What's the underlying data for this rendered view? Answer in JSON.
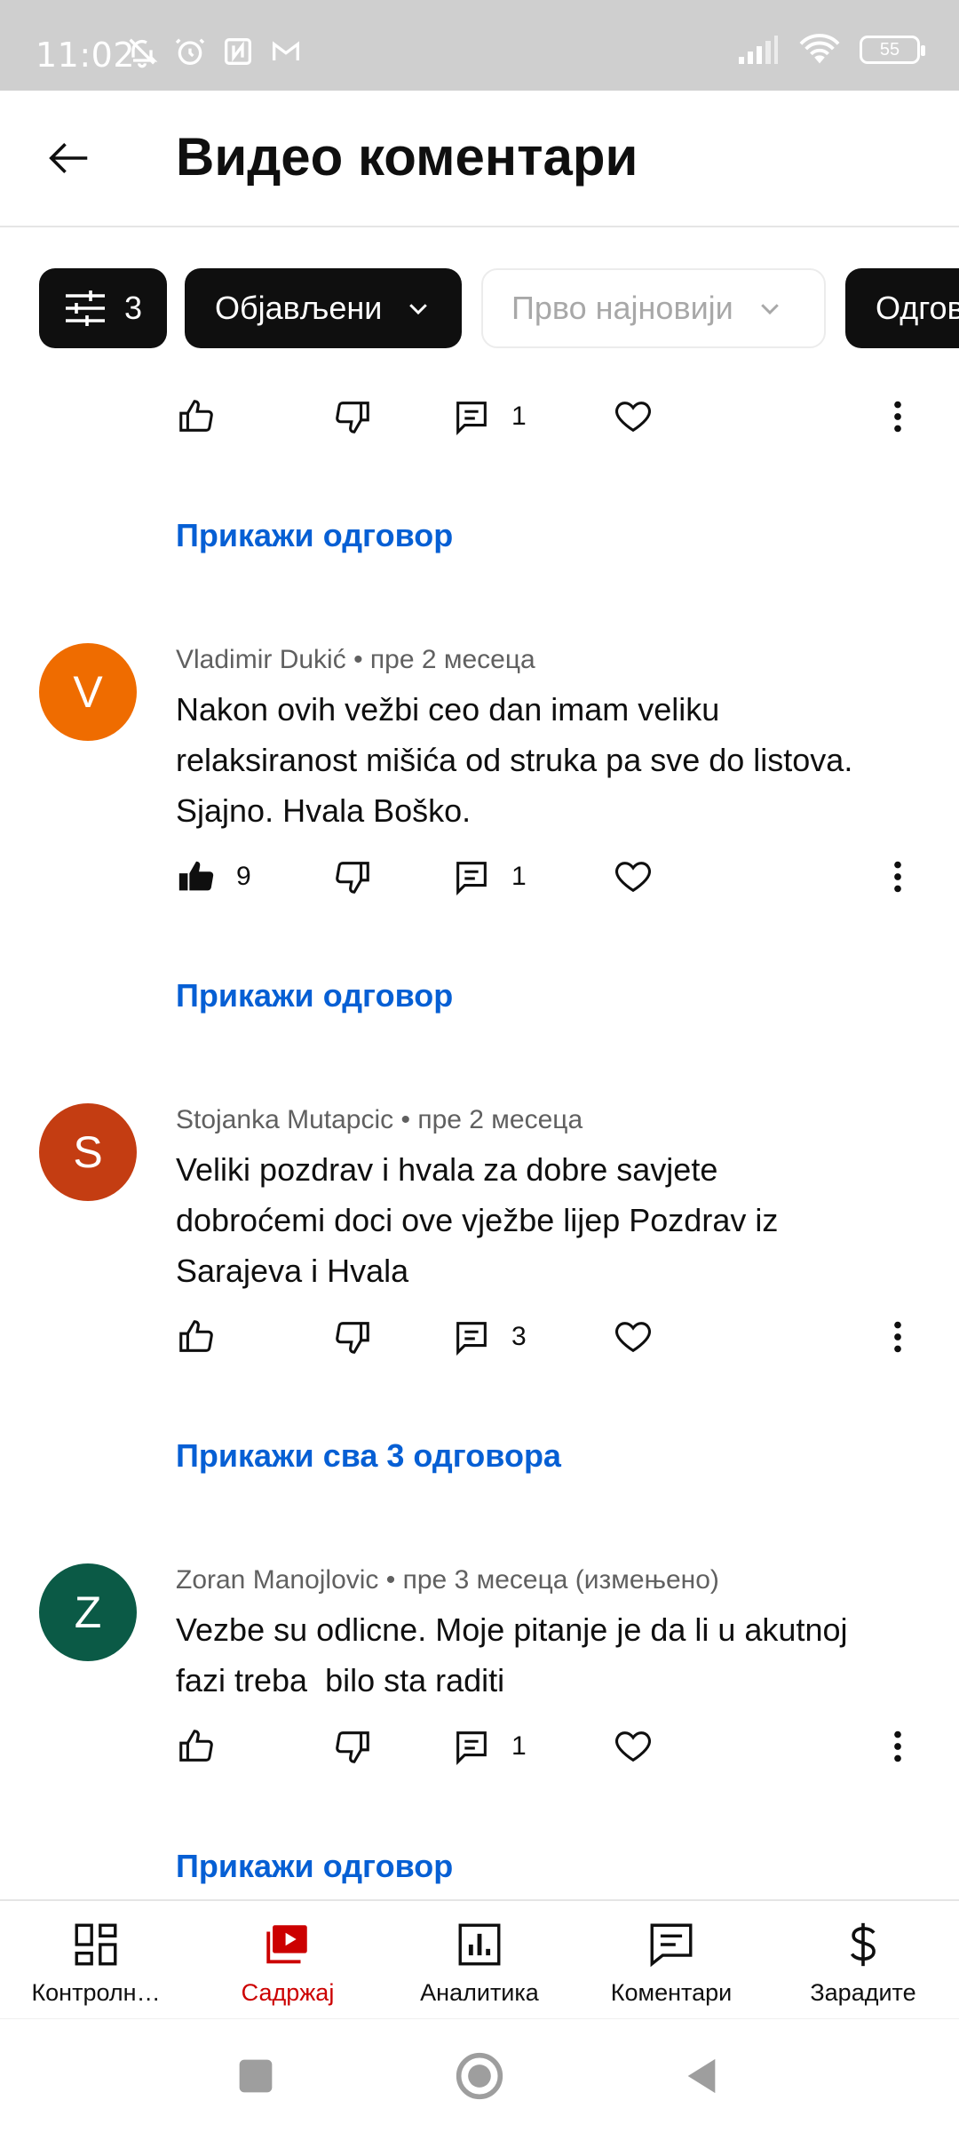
{
  "status_bar": {
    "time": "11:02",
    "battery": "55"
  },
  "header": {
    "title": "Видео коментари"
  },
  "filters": {
    "filter_count": "3",
    "published": "Објављени",
    "order": "Прво најновији",
    "reply": "Одговор"
  },
  "top_partial": {
    "replies": "1",
    "show_replies": "Прикажи одговор"
  },
  "comments": [
    {
      "initial": "V",
      "avatar_color": "#ef6c00",
      "author": "Vladimir Dukić",
      "time": "пре 2 месеца",
      "text": "Nakon ovih vežbi ceo dan imam veliku relaksiranost mišića od struka pa sve do listova. Sjajno. Hvala Boško.",
      "likes": "9",
      "replies": "1",
      "show_replies": "Прикажи одговор",
      "liked": true
    },
    {
      "initial": "S",
      "avatar_color": "#c43d12",
      "author": "Stojanka Mutapcic",
      "time": "пре 2 месеца",
      "text": "Veliki pozdrav i hvala za dobre savjete dobroćemi doci ove vježbe lijep Pozdrav iz Sarajeva i Hvala",
      "likes": "",
      "replies": "3",
      "show_replies": "Прикажи сва 3 одговора",
      "liked": false
    },
    {
      "initial": "Z",
      "avatar_color": "#0b5a46",
      "author": "Zoran Manojlovic",
      "time": "пре 3 месеца (измењено)",
      "text": "Vezbe su odlicne. Moje pitanje je da li u akutnoj fazi treba  bilo sta raditi",
      "likes": "",
      "replies": "1",
      "show_replies": "Прикажи одговор",
      "liked": false
    }
  ],
  "bottom_nav": [
    {
      "label": "Контролн…",
      "icon": "dashboard-icon"
    },
    {
      "label": "Садржај",
      "icon": "content-icon",
      "active": true
    },
    {
      "label": "Аналитика",
      "icon": "analytics-icon"
    },
    {
      "label": "Коментари",
      "icon": "comments-icon"
    },
    {
      "label": "Зарадите",
      "icon": "earn-icon"
    }
  ],
  "colors": {
    "link": "#065fd4",
    "active_nav": "#cc0000",
    "chip_dark": "#0f0f0f"
  }
}
